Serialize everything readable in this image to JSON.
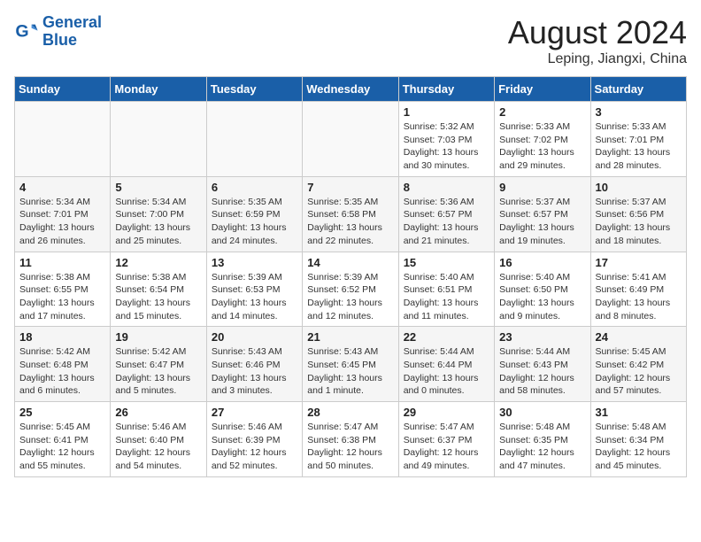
{
  "logo": {
    "line1": "General",
    "line2": "Blue"
  },
  "title": "August 2024",
  "subtitle": "Leping, Jiangxi, China",
  "days_of_week": [
    "Sunday",
    "Monday",
    "Tuesday",
    "Wednesday",
    "Thursday",
    "Friday",
    "Saturday"
  ],
  "weeks": [
    [
      {
        "day": "",
        "info": ""
      },
      {
        "day": "",
        "info": ""
      },
      {
        "day": "",
        "info": ""
      },
      {
        "day": "",
        "info": ""
      },
      {
        "day": "1",
        "info": "Sunrise: 5:32 AM\nSunset: 7:03 PM\nDaylight: 13 hours and 30 minutes."
      },
      {
        "day": "2",
        "info": "Sunrise: 5:33 AM\nSunset: 7:02 PM\nDaylight: 13 hours and 29 minutes."
      },
      {
        "day": "3",
        "info": "Sunrise: 5:33 AM\nSunset: 7:01 PM\nDaylight: 13 hours and 28 minutes."
      }
    ],
    [
      {
        "day": "4",
        "info": "Sunrise: 5:34 AM\nSunset: 7:01 PM\nDaylight: 13 hours and 26 minutes."
      },
      {
        "day": "5",
        "info": "Sunrise: 5:34 AM\nSunset: 7:00 PM\nDaylight: 13 hours and 25 minutes."
      },
      {
        "day": "6",
        "info": "Sunrise: 5:35 AM\nSunset: 6:59 PM\nDaylight: 13 hours and 24 minutes."
      },
      {
        "day": "7",
        "info": "Sunrise: 5:35 AM\nSunset: 6:58 PM\nDaylight: 13 hours and 22 minutes."
      },
      {
        "day": "8",
        "info": "Sunrise: 5:36 AM\nSunset: 6:57 PM\nDaylight: 13 hours and 21 minutes."
      },
      {
        "day": "9",
        "info": "Sunrise: 5:37 AM\nSunset: 6:57 PM\nDaylight: 13 hours and 19 minutes."
      },
      {
        "day": "10",
        "info": "Sunrise: 5:37 AM\nSunset: 6:56 PM\nDaylight: 13 hours and 18 minutes."
      }
    ],
    [
      {
        "day": "11",
        "info": "Sunrise: 5:38 AM\nSunset: 6:55 PM\nDaylight: 13 hours and 17 minutes."
      },
      {
        "day": "12",
        "info": "Sunrise: 5:38 AM\nSunset: 6:54 PM\nDaylight: 13 hours and 15 minutes."
      },
      {
        "day": "13",
        "info": "Sunrise: 5:39 AM\nSunset: 6:53 PM\nDaylight: 13 hours and 14 minutes."
      },
      {
        "day": "14",
        "info": "Sunrise: 5:39 AM\nSunset: 6:52 PM\nDaylight: 13 hours and 12 minutes."
      },
      {
        "day": "15",
        "info": "Sunrise: 5:40 AM\nSunset: 6:51 PM\nDaylight: 13 hours and 11 minutes."
      },
      {
        "day": "16",
        "info": "Sunrise: 5:40 AM\nSunset: 6:50 PM\nDaylight: 13 hours and 9 minutes."
      },
      {
        "day": "17",
        "info": "Sunrise: 5:41 AM\nSunset: 6:49 PM\nDaylight: 13 hours and 8 minutes."
      }
    ],
    [
      {
        "day": "18",
        "info": "Sunrise: 5:42 AM\nSunset: 6:48 PM\nDaylight: 13 hours and 6 minutes."
      },
      {
        "day": "19",
        "info": "Sunrise: 5:42 AM\nSunset: 6:47 PM\nDaylight: 13 hours and 5 minutes."
      },
      {
        "day": "20",
        "info": "Sunrise: 5:43 AM\nSunset: 6:46 PM\nDaylight: 13 hours and 3 minutes."
      },
      {
        "day": "21",
        "info": "Sunrise: 5:43 AM\nSunset: 6:45 PM\nDaylight: 13 hours and 1 minute."
      },
      {
        "day": "22",
        "info": "Sunrise: 5:44 AM\nSunset: 6:44 PM\nDaylight: 13 hours and 0 minutes."
      },
      {
        "day": "23",
        "info": "Sunrise: 5:44 AM\nSunset: 6:43 PM\nDaylight: 12 hours and 58 minutes."
      },
      {
        "day": "24",
        "info": "Sunrise: 5:45 AM\nSunset: 6:42 PM\nDaylight: 12 hours and 57 minutes."
      }
    ],
    [
      {
        "day": "25",
        "info": "Sunrise: 5:45 AM\nSunset: 6:41 PM\nDaylight: 12 hours and 55 minutes."
      },
      {
        "day": "26",
        "info": "Sunrise: 5:46 AM\nSunset: 6:40 PM\nDaylight: 12 hours and 54 minutes."
      },
      {
        "day": "27",
        "info": "Sunrise: 5:46 AM\nSunset: 6:39 PM\nDaylight: 12 hours and 52 minutes."
      },
      {
        "day": "28",
        "info": "Sunrise: 5:47 AM\nSunset: 6:38 PM\nDaylight: 12 hours and 50 minutes."
      },
      {
        "day": "29",
        "info": "Sunrise: 5:47 AM\nSunset: 6:37 PM\nDaylight: 12 hours and 49 minutes."
      },
      {
        "day": "30",
        "info": "Sunrise: 5:48 AM\nSunset: 6:35 PM\nDaylight: 12 hours and 47 minutes."
      },
      {
        "day": "31",
        "info": "Sunrise: 5:48 AM\nSunset: 6:34 PM\nDaylight: 12 hours and 45 minutes."
      }
    ]
  ]
}
